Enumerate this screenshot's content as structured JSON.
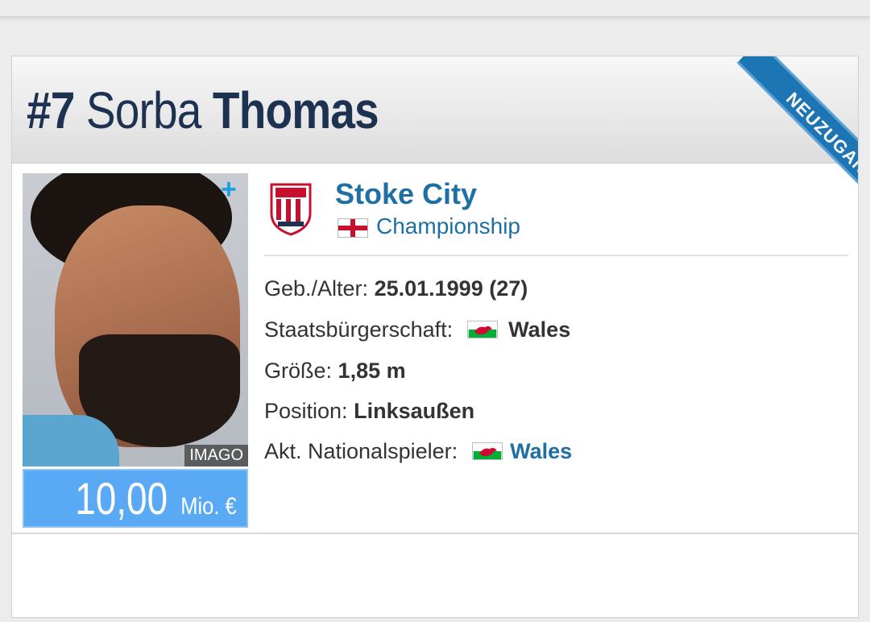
{
  "player": {
    "number": "#7",
    "first_name": "Sorba",
    "last_name": "Thomas",
    "badge": "NEUZUGANG",
    "photo_credit": "IMAGO",
    "market_value": {
      "amount": "10,00",
      "unit": "Mio. €"
    }
  },
  "club": {
    "name": "Stoke City",
    "league": "Championship",
    "league_country_icon": "england-flag-icon",
    "crest_icon": "stoke-city-crest-icon"
  },
  "info": {
    "birth_label": "Geb./Alter:",
    "birth_value": "25.01.1999 (27)",
    "citizenship_label": "Staatsbürgerschaft:",
    "citizenship_value": "Wales",
    "height_label": "Größe:",
    "height_value": "1,85 m",
    "position_label": "Position:",
    "position_value": "Linksaußen",
    "national_label": "Akt. Nationalspieler:",
    "national_value": "Wales",
    "flag_icon": "wales-flag-icon"
  },
  "colors": {
    "title": "#1d3251",
    "link": "#1e6fa3",
    "ribbon": "#1d75b3",
    "value_box": "#5aa9f5"
  }
}
